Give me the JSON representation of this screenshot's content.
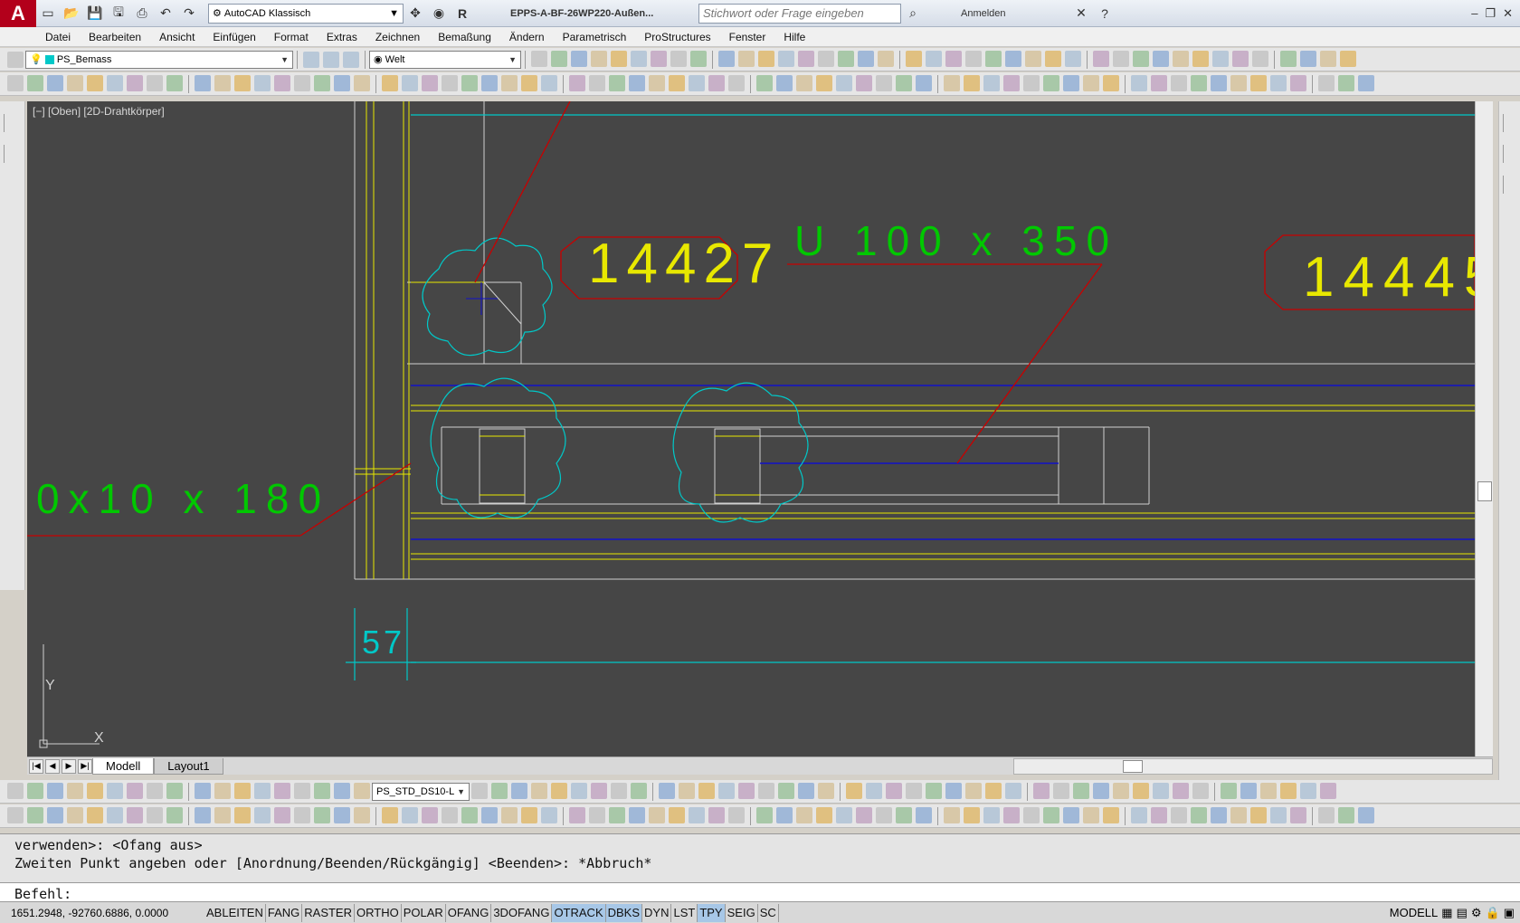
{
  "titlebar": {
    "app_logo": "A",
    "workspace": "AutoCAD Klassisch",
    "document_title": "EPPS-A-BF-26WP220-Außen...",
    "search_placeholder": "Stichwort oder Frage eingeben",
    "signin": "Anmelden"
  },
  "menu": [
    "Datei",
    "Bearbeiten",
    "Ansicht",
    "Einfügen",
    "Format",
    "Extras",
    "Zeichnen",
    "Bemaßung",
    "Ändern",
    "Parametrisch",
    "ProStructures",
    "Fenster",
    "Hilfe"
  ],
  "toolbar": {
    "layer_combo": "PS_Bemass",
    "ucs_combo": "Welt",
    "dimstyle_combo": "PS_STD_DS10-L"
  },
  "viewport": {
    "label": "[−] [Oben] [2D-Drahtkörper]",
    "texts": {
      "tag1": "14427",
      "tag2": "14445",
      "profile1": "U 100 x 350",
      "profile2": "0x10 x 180",
      "dim": "57",
      "ucs_y": "Y",
      "ucs_x": "X"
    },
    "colors": {
      "background": "#464646",
      "yellow": "#e8e800",
      "cyan": "#00c8c8",
      "red": "#c80000",
      "blue": "#1010c8",
      "green": "#00c800",
      "white": "#d0d0d0"
    }
  },
  "tabs": {
    "model": "Modell",
    "layout": "Layout1"
  },
  "command": {
    "history": [
      "verwenden>:  <Ofang aus>",
      "Zweiten Punkt angeben oder [Anordnung/Beenden/Rückgängig] <Beenden>: *Abbruch*"
    ],
    "prompt": "Befehl:"
  },
  "status": {
    "coords": "1651.2948, -92760.6886, 0.0000",
    "buttons": [
      {
        "label": "ABLEITEN",
        "on": false
      },
      {
        "label": "FANG",
        "on": false
      },
      {
        "label": "RASTER",
        "on": false
      },
      {
        "label": "ORTHO",
        "on": false
      },
      {
        "label": "POLAR",
        "on": false
      },
      {
        "label": "OFANG",
        "on": false
      },
      {
        "label": "3DOFANG",
        "on": false
      },
      {
        "label": "OTRACK",
        "on": true
      },
      {
        "label": "DBKS",
        "on": true
      },
      {
        "label": "DYN",
        "on": false
      },
      {
        "label": "LST",
        "on": false
      },
      {
        "label": "TPY",
        "on": true
      },
      {
        "label": "SEIG",
        "on": false
      },
      {
        "label": "SC",
        "on": false
      }
    ],
    "model": "MODELL"
  }
}
